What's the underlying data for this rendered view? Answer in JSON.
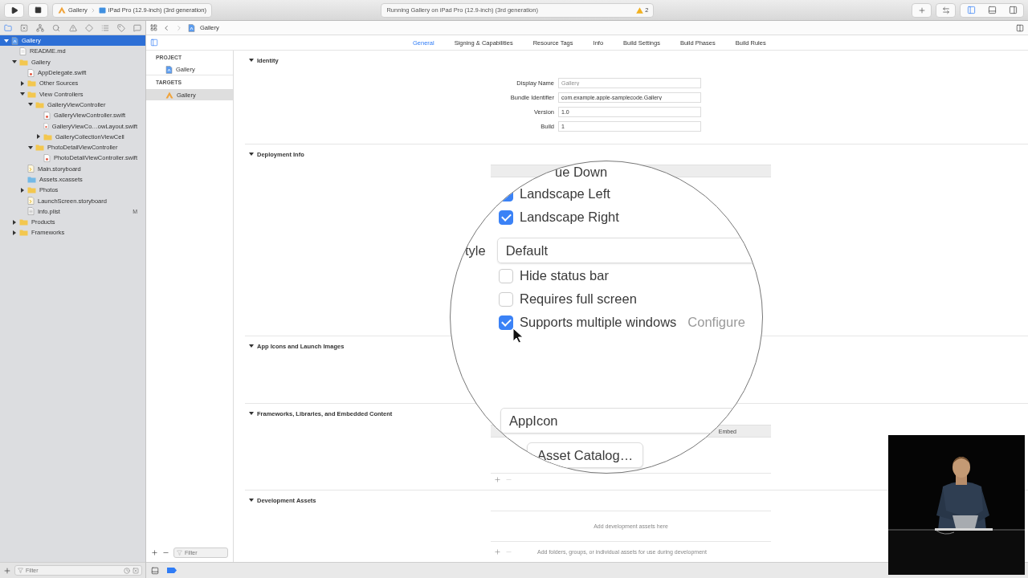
{
  "toolbar": {
    "scheme": {
      "target": "Gallery",
      "device": "iPad Pro (12.9-inch) (3rd generation)"
    },
    "activity": {
      "status": "Running Gallery on iPad Pro (12.9-inch) (3rd generation)",
      "warnings": "2"
    },
    "panel_toggles": [
      {
        "kind": "navigator",
        "selected": true
      },
      {
        "kind": "debug",
        "selected": false
      },
      {
        "kind": "inspector",
        "selected": false
      }
    ]
  },
  "navigator": {
    "tabs": [
      {
        "kind": "project",
        "selected": true
      },
      {
        "kind": "source-control",
        "selected": false
      },
      {
        "kind": "symbol",
        "selected": false
      },
      {
        "kind": "find",
        "selected": false
      },
      {
        "kind": "issue",
        "selected": false
      },
      {
        "kind": "test",
        "selected": false
      },
      {
        "kind": "debug",
        "selected": false
      },
      {
        "kind": "breakpoint",
        "selected": false
      },
      {
        "kind": "report",
        "selected": false
      }
    ],
    "tree": [
      {
        "name": "Gallery",
        "kind": "project",
        "expanded": true,
        "selected": true,
        "children": [
          {
            "name": "README.md",
            "kind": "markdown",
            "selected": false
          },
          {
            "name": "Gallery",
            "kind": "folder",
            "expanded": true,
            "selected": false,
            "children": [
              {
                "name": "AppDelegate.swift",
                "kind": "swift",
                "selected": false
              },
              {
                "name": "Other Sources",
                "kind": "folder",
                "expanded": false,
                "selected": false
              },
              {
                "name": "View Controllers",
                "kind": "folder",
                "expanded": true,
                "selected": false,
                "children": [
                  {
                    "name": "GalleryViewController",
                    "kind": "folder",
                    "expanded": true,
                    "selected": false,
                    "children": [
                      {
                        "name": "GalleryViewController.swift",
                        "kind": "swift",
                        "selected": false
                      },
                      {
                        "name": "GalleryViewCo…owLayout.swift",
                        "kind": "swift",
                        "selected": false
                      },
                      {
                        "name": "GalleryCollectionViewCell",
                        "kind": "folder",
                        "expanded": false,
                        "selected": false
                      }
                    ]
                  },
                  {
                    "name": "PhotoDetailViewController",
                    "kind": "folder",
                    "expanded": true,
                    "selected": false,
                    "children": [
                      {
                        "name": "PhotoDetailViewController.swift",
                        "kind": "swift",
                        "selected": false
                      }
                    ]
                  }
                ]
              },
              {
                "name": "Main.storyboard",
                "kind": "storyboard",
                "selected": false
              },
              {
                "name": "Assets.xcassets",
                "kind": "assets",
                "selected": false
              },
              {
                "name": "Photos",
                "kind": "folder",
                "expanded": false,
                "selected": false
              },
              {
                "name": "LaunchScreen.storyboard",
                "kind": "storyboard",
                "selected": false
              },
              {
                "name": "Info.plist",
                "kind": "plist",
                "selected": false,
                "badge": "M"
              }
            ]
          },
          {
            "name": "Products",
            "kind": "folder",
            "expanded": false,
            "selected": false
          },
          {
            "name": "Frameworks",
            "kind": "folder",
            "expanded": false,
            "selected": false
          }
        ]
      }
    ],
    "filter": {
      "placeholder": "Filter"
    }
  },
  "jump_bar": {
    "path": "Gallery"
  },
  "editor_tabs": [
    {
      "label": "General",
      "selected": true
    },
    {
      "label": "Signing & Capabilities",
      "selected": false
    },
    {
      "label": "Resource Tags",
      "selected": false
    },
    {
      "label": "Info",
      "selected": false
    },
    {
      "label": "Build Settings",
      "selected": false
    },
    {
      "label": "Build Phases",
      "selected": false
    },
    {
      "label": "Build Rules",
      "selected": false
    }
  ],
  "target_list": {
    "groups": [
      {
        "title": "PROJECT",
        "items": [
          {
            "name": "Gallery",
            "kind": "project",
            "selected": false
          }
        ]
      },
      {
        "title": "TARGETS",
        "items": [
          {
            "name": "Gallery",
            "kind": "app",
            "selected": true
          }
        ]
      }
    ],
    "filter": {
      "placeholder": "Filter"
    }
  },
  "sections": [
    {
      "title": "Identity",
      "kind": "form",
      "expanded": true,
      "fields": [
        {
          "label": "Display Name",
          "placeholder": "Gallery"
        },
        {
          "label": "Bundle Identifier",
          "value": "com.example.apple-samplecode.Gallery"
        },
        {
          "label": "Version",
          "value": "1.0"
        },
        {
          "label": "Build",
          "value": "1"
        }
      ]
    },
    {
      "title": "Deployment Info",
      "kind": "orientation",
      "expanded": true
    },
    {
      "title": "App Icons and Launch Images",
      "kind": "icons",
      "expanded": true
    },
    {
      "title": "Frameworks, Libraries, and Embedded Content",
      "kind": "frameworks",
      "expanded": true,
      "columns": [
        {
          "label": "Embed"
        }
      ]
    },
    {
      "title": "Development Assets",
      "kind": "assets",
      "expanded": true,
      "empty_message": "Add development assets here",
      "hint": "Add folders, groups, or individual assets for use during development"
    }
  ],
  "magnifier": {
    "items": [
      {
        "kind": "text",
        "text": "ue Down"
      },
      {
        "kind": "checkbox",
        "label": "Landscape Left",
        "checked": true
      },
      {
        "kind": "checkbox",
        "label": "Landscape Right",
        "checked": true
      },
      {
        "kind": "popup",
        "label": "tyle",
        "value": "Default"
      },
      {
        "kind": "checkbox",
        "label": "Hide status bar",
        "checked": false
      },
      {
        "kind": "checkbox",
        "label": "Requires full screen",
        "checked": false
      },
      {
        "kind": "checkbox",
        "label": "Supports multiple windows",
        "checked": true,
        "link": "Configure"
      },
      {
        "kind": "field",
        "value": "AppIcon"
      },
      {
        "kind": "button",
        "label": "Asset Catalog…"
      }
    ]
  }
}
